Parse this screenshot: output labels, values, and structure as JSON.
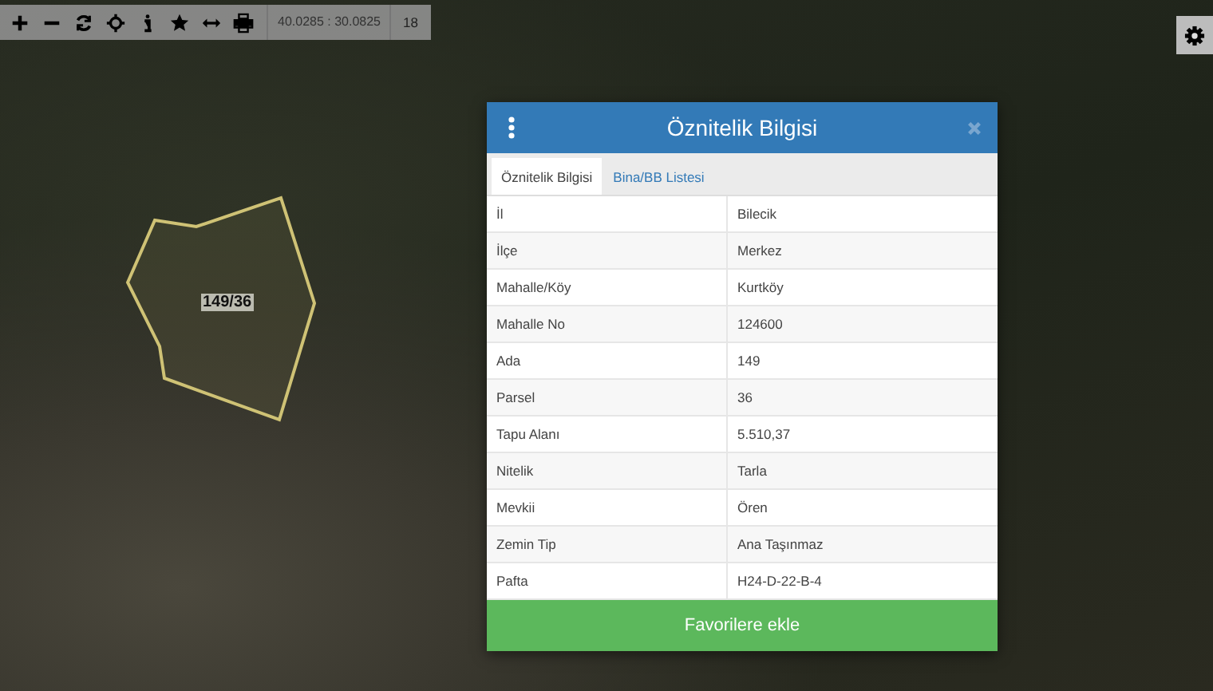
{
  "toolbar": {
    "tools": [
      {
        "kind": "zoom-in"
      },
      {
        "kind": "zoom-out"
      },
      {
        "kind": "refresh"
      },
      {
        "kind": "locate"
      },
      {
        "kind": "info"
      },
      {
        "kind": "star"
      },
      {
        "kind": "measure"
      },
      {
        "kind": "print"
      }
    ],
    "coordinates": "40.0285 : 30.0825",
    "zoom_level": "18"
  },
  "map": {
    "parcel_label": "149/36"
  },
  "dialog": {
    "title": "Öznitelik Bilgisi",
    "tabs": [
      {
        "label": "Öznitelik Bilgisi",
        "selected": true
      },
      {
        "label": "Bina/BB Listesi",
        "selected": false
      }
    ],
    "rows": [
      {
        "label": "İl",
        "value": "Bilecik"
      },
      {
        "label": "İlçe",
        "value": "Merkez"
      },
      {
        "label": "Mahalle/Köy",
        "value": "Kurtköy"
      },
      {
        "label": "Mahalle No",
        "value": "124600"
      },
      {
        "label": "Ada",
        "value": "149"
      },
      {
        "label": "Parsel",
        "value": "36"
      },
      {
        "label": "Tapu Alanı",
        "value": "5.510,37"
      },
      {
        "label": "Nitelik",
        "value": "Tarla"
      },
      {
        "label": "Mevkii",
        "value": "Ören"
      },
      {
        "label": "Zemin Tip",
        "value": "Ana Taşınmaz"
      },
      {
        "label": "Pafta",
        "value": "H24-D-22-B-4"
      }
    ],
    "button": "Favorilere ekle"
  }
}
